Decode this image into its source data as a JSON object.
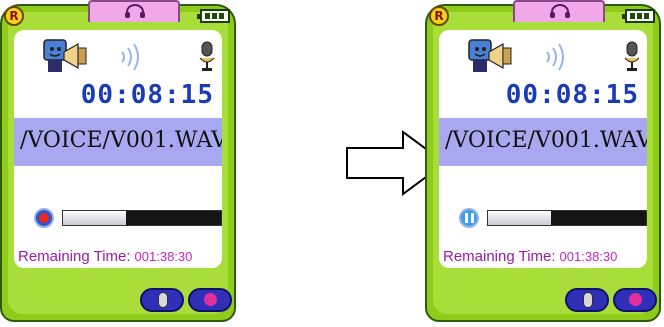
{
  "devices": [
    {
      "state": "recording",
      "timer": "00:08:15",
      "file_path": "/VOICE/V001.WAV",
      "remaining_label": "Remaining Time:",
      "remaining_value": "001:38:30",
      "progress_fraction": 0.4,
      "badge": "R"
    },
    {
      "state": "paused",
      "timer": "00:08:15",
      "file_path": "/VOICE/V001.WAV",
      "remaining_label": "Remaining Time:",
      "remaining_value": "001:38:30",
      "progress_fraction": 0.4,
      "badge": "R"
    }
  ],
  "colors": {
    "frame": "#8fcc1a",
    "timer": "#1a3bb8",
    "path_bar": "#a8a8f0",
    "remaining_label": "#9a1aa8",
    "remaining_value": "#c824c8",
    "record_dot": "#e8281e"
  },
  "icons": [
    "headphone-icon",
    "battery-icon",
    "speaker-character-icon",
    "sound-waves-icon",
    "microphone-icon",
    "record-icon",
    "pause-icon",
    "right-arrow-icon"
  ]
}
